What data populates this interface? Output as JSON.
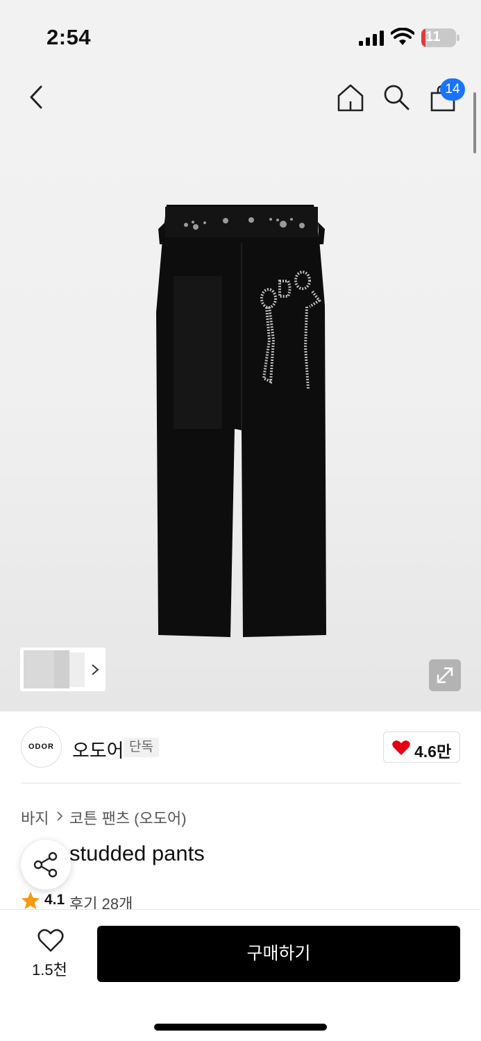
{
  "status_bar": {
    "time": "2:54",
    "battery": "11",
    "battery_level": 0.11
  },
  "nav": {
    "cart_count": "14"
  },
  "brand": {
    "logo_text": "ODOR",
    "name": "오도어",
    "badge": "단독",
    "likes": "4.6만"
  },
  "breadcrumb": {
    "category": "바지",
    "subcategory": "코튼 팬츠 (오도어)"
  },
  "product": {
    "title": "studded pants",
    "rating": "4.1",
    "reviews": "후기 28개"
  },
  "bottom": {
    "wish_count": "1.5천",
    "buy_label": "구매하기"
  },
  "colors": {
    "accent": "#1a73ff",
    "heart": "#e60012",
    "star": "#f59a13",
    "button": "#000000"
  }
}
